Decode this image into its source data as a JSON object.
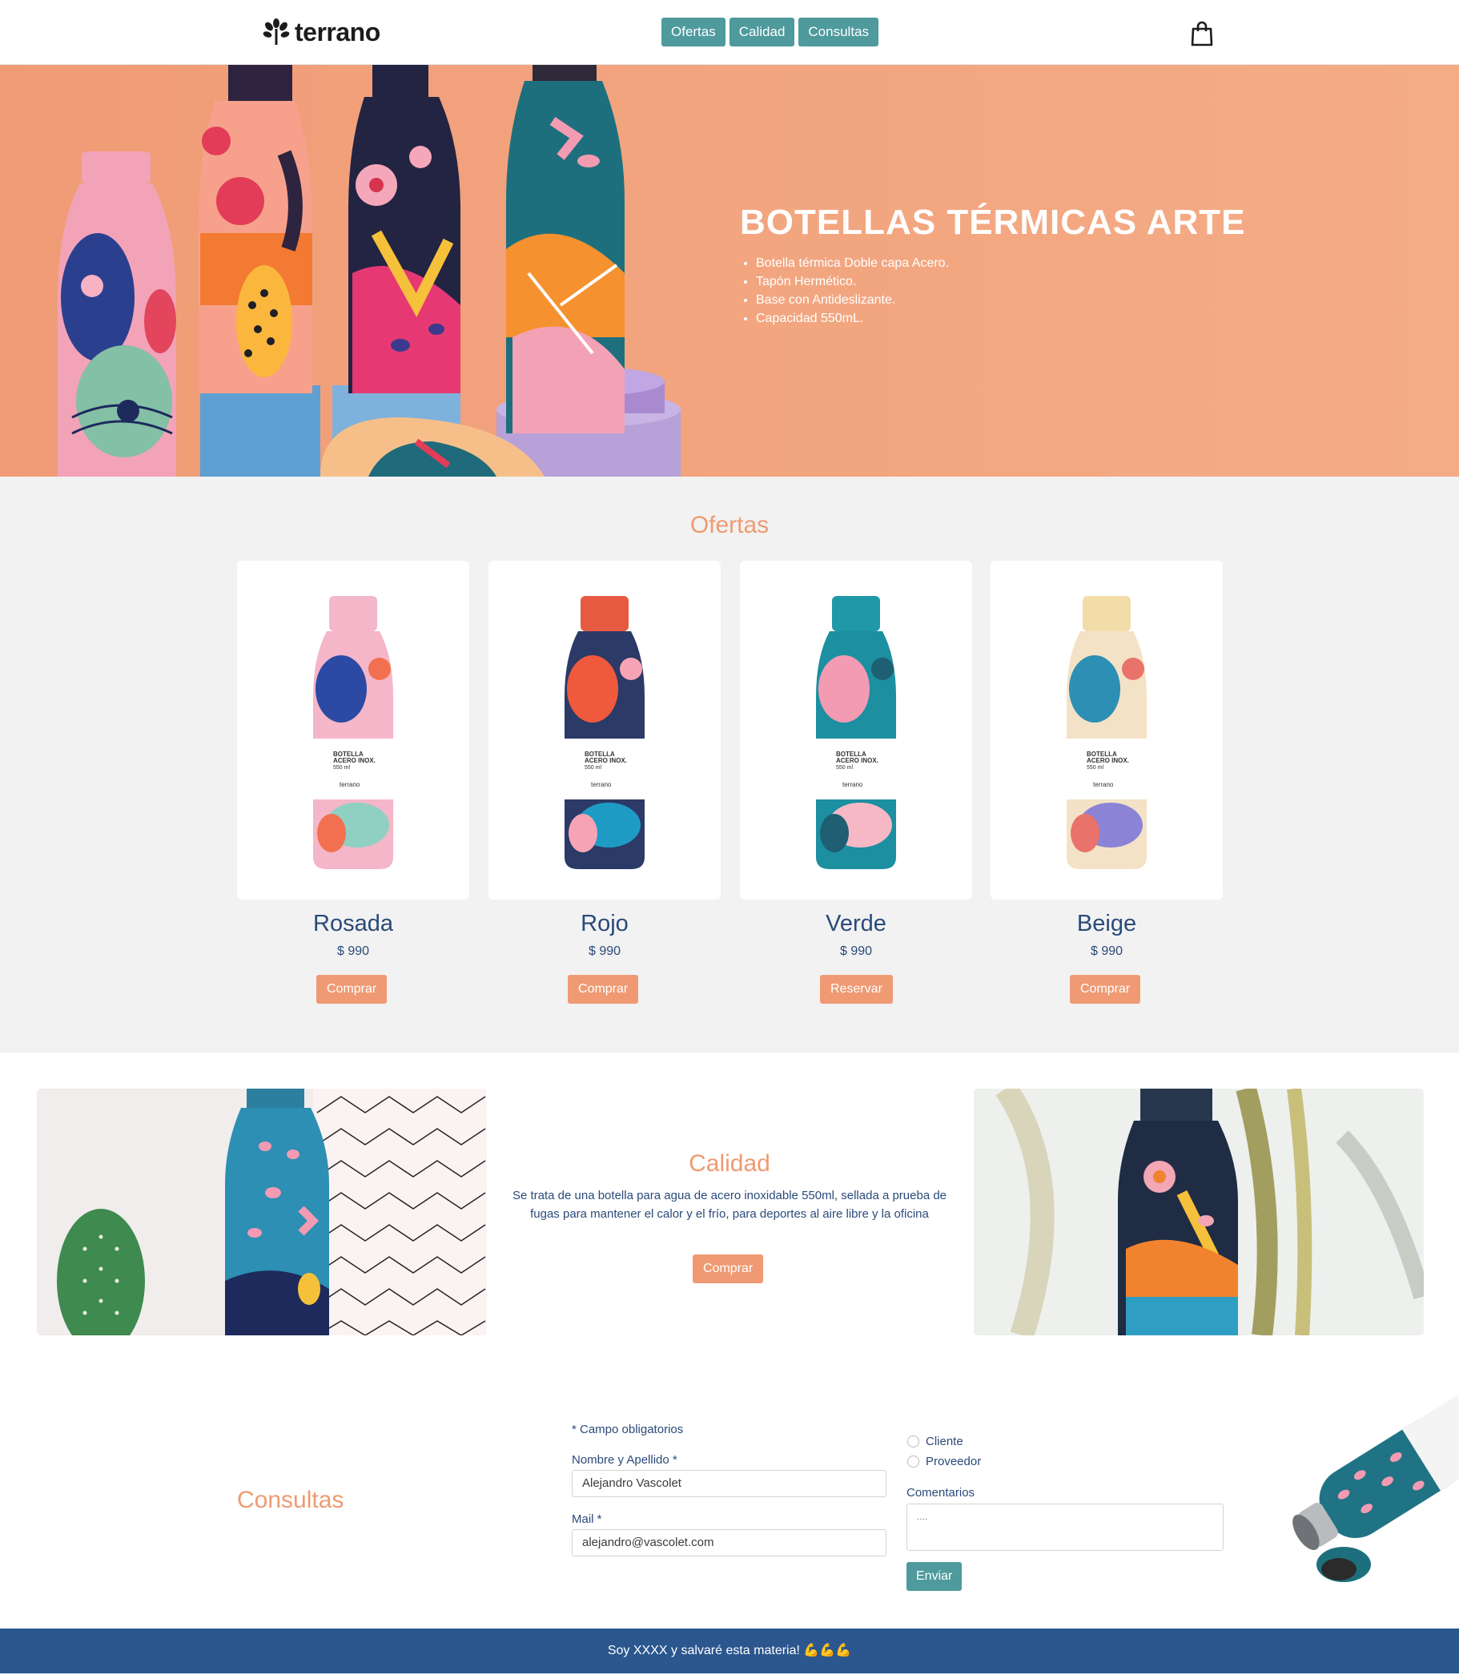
{
  "header": {
    "logo_text": "terrano",
    "nav": [
      "Ofertas",
      "Calidad",
      "Consultas"
    ],
    "cart_icon": "shopping-bag-icon"
  },
  "hero": {
    "title": "BOTELLAS TÉRMICAS ARTE",
    "features": [
      "Botella térmica Doble capa Acero.",
      "Tapón Hermético.",
      "Base con Antideslizante.",
      "Capacidad 550mL."
    ]
  },
  "ofertas": {
    "title": "Ofertas",
    "products": [
      {
        "name": "Rosada",
        "price": "$ 990",
        "button": "Comprar",
        "label_l1": "BOTELLA",
        "label_l2": "ACERO INOX.",
        "label_l3": "550 ml",
        "brand": "terrano"
      },
      {
        "name": "Rojo",
        "price": "$ 990",
        "button": "Comprar",
        "label_l1": "BOTELLA",
        "label_l2": "ACERO INOX.",
        "label_l3": "550 ml",
        "brand": "terrano"
      },
      {
        "name": "Verde",
        "price": "$ 990",
        "button": "Reservar",
        "label_l1": "BOTELLA",
        "label_l2": "ACERO INOX.",
        "label_l3": "550 ml",
        "brand": "terrano"
      },
      {
        "name": "Beige",
        "price": "$ 990",
        "button": "Comprar",
        "label_l1": "BOTELLA",
        "label_l2": "ACERO INOX.",
        "label_l3": "550 ml",
        "brand": "terrano"
      }
    ]
  },
  "calidad": {
    "title": "Calidad",
    "text": "Se trata de una botella para agua de acero inoxidable 550ml, sellada a prueba de fugas para mantener el calor y el frío, para deportes al aire libre y la oficina",
    "button": "Comprar"
  },
  "consultas": {
    "title": "Consultas",
    "required_note": "* Campo obligatorios",
    "name_label": "Nombre y Apellido *",
    "name_value": "Alejandro Vascolet",
    "mail_label": "Mail *",
    "mail_value": "alejandro@vascolet.com",
    "radio_options": [
      "Cliente",
      "Proveedor"
    ],
    "comments_label": "Comentarios",
    "comments_placeholder": "....",
    "submit": "Enviar"
  },
  "footer": {
    "text": "Soy XXXX y salvaré esta materia! 💪💪💪"
  },
  "colors": {
    "teal": "#4e9a9d",
    "orange": "#ef9a73",
    "navy": "#2a4a7a",
    "footer": "#2b578e",
    "hero_bg": "#f2a57f"
  }
}
